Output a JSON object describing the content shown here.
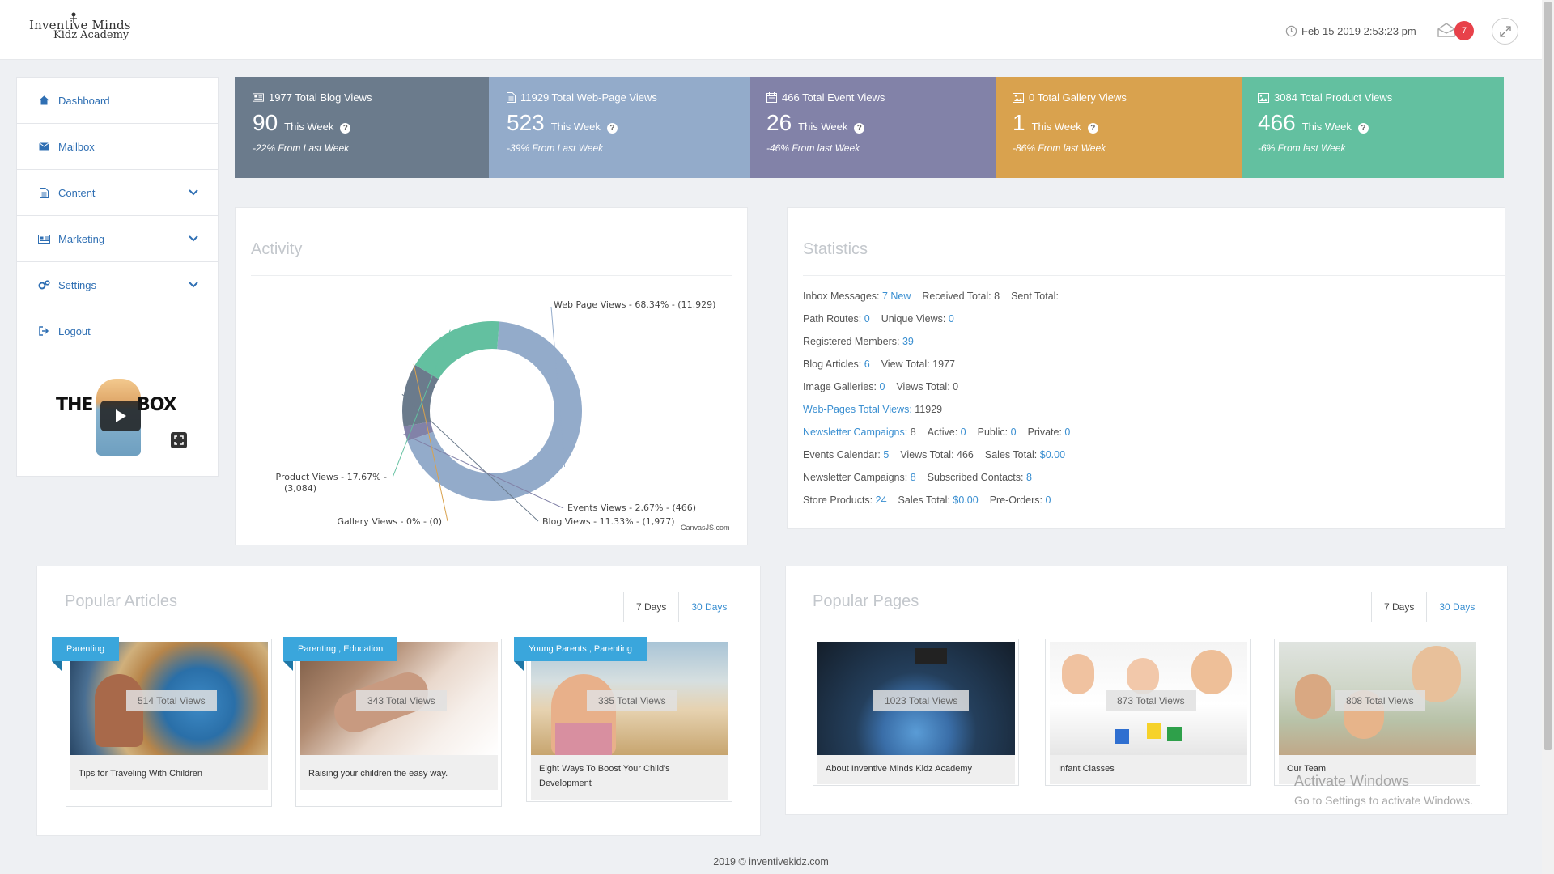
{
  "header": {
    "logo_line1": "Inventive Minds",
    "logo_line2": "Kidz Academy",
    "datetime": "Feb 15 2019 2:53:23 pm",
    "notification_count": "7"
  },
  "sidebar": {
    "items": [
      {
        "label": "Dashboard",
        "icon": "home-icon"
      },
      {
        "label": "Mailbox",
        "icon": "envelope-icon"
      },
      {
        "label": "Content",
        "icon": "document-icon",
        "expandable": true
      },
      {
        "label": "Marketing",
        "icon": "newspaper-icon",
        "expandable": true
      },
      {
        "label": "Settings",
        "icon": "gears-icon",
        "expandable": true
      },
      {
        "label": "Logout",
        "icon": "sign-out-icon"
      }
    ],
    "promo_left": "THE",
    "promo_right": "BOX"
  },
  "tiles": [
    {
      "heading": "1977 Total Blog Views",
      "number": "90",
      "period": "This Week",
      "change": "-22% From Last Week",
      "color": "#6b7b8c",
      "icon": "newspaper-icon"
    },
    {
      "heading": "11929 Total Web-Page Views",
      "number": "523",
      "period": "This Week",
      "change": "-39% From Last Week",
      "color": "#93abca",
      "icon": "file-icon"
    },
    {
      "heading": "466 Total Event Views",
      "number": "26",
      "period": "This Week",
      "change": "-46% From last Week",
      "color": "#8282a8",
      "icon": "calendar-icon"
    },
    {
      "heading": "0 Total Gallery Views",
      "number": "1",
      "period": "This Week",
      "change": "-86% From last Week",
      "color": "#d9a24e",
      "icon": "picture-icon"
    },
    {
      "heading": "3084 Total Product Views",
      "number": "466",
      "period": "This Week",
      "change": "-6% From last Week",
      "color": "#63c0a0",
      "icon": "picture-icon"
    }
  ],
  "activity": {
    "title": "Activity",
    "credit": "CanvasJS.com"
  },
  "chart_data": {
    "type": "pie",
    "donut": true,
    "categories": [
      "Web Page Views",
      "Events Views",
      "Blog Views",
      "Gallery Views",
      "Product Views"
    ],
    "values": [
      11929,
      466,
      1977,
      0,
      3084
    ],
    "labels": [
      "Web Page Views - 68.34% - (11,929)",
      "Events Views - 2.67% - (466)",
      "Blog Views - 11.33% - (1,977)",
      "Gallery Views - 0% - (0)",
      "Product Views - 17.67% -"
    ],
    "label_extra": "(3,084)",
    "colors": [
      "#93abca",
      "#8282a8",
      "#6b7b8c",
      "#d9a24e",
      "#63c0a0"
    ]
  },
  "statistics": {
    "title": "Statistics",
    "rows": [
      [
        {
          "t": "Inbox Messages: "
        },
        {
          "t": "7 New",
          "link": true
        },
        {
          "t": "Received Total: 8"
        },
        {
          "t": "Sent Total:"
        }
      ],
      [
        {
          "t": "Path Routes: "
        },
        {
          "t": "0",
          "link": true
        },
        {
          "t": "Unique Views: "
        },
        {
          "t": "0",
          "link": true
        }
      ],
      [
        {
          "t": "Registered Members: "
        },
        {
          "t": "39",
          "link": true
        }
      ],
      [
        {
          "t": "Blog Articles: "
        },
        {
          "t": "6",
          "link": true
        },
        {
          "t": "View Total: 1977"
        }
      ],
      [
        {
          "t": "Image Galleries: "
        },
        {
          "t": "0",
          "link": true
        },
        {
          "t": "Views Total: 0"
        }
      ],
      [
        {
          "t": "Web-Pages Total Views:",
          "link": true
        },
        {
          "t": " 11929"
        }
      ],
      [
        {
          "t": "Newsletter Campaigns:",
          "link": true
        },
        {
          "t": " 8"
        },
        {
          "t": "Active: "
        },
        {
          "t": "0",
          "link": true
        },
        {
          "t": "Public: "
        },
        {
          "t": "0",
          "link": true
        },
        {
          "t": "Private: "
        },
        {
          "t": "0",
          "link": true
        }
      ],
      [
        {
          "t": "Events Calendar: "
        },
        {
          "t": "5",
          "link": true
        },
        {
          "t": "Views Total: 466"
        },
        {
          "t": "Sales Total: "
        },
        {
          "t": "$0.00",
          "link": true
        }
      ],
      [
        {
          "t": "Newsletter Campaigns: "
        },
        {
          "t": "8",
          "link": true
        },
        {
          "t": "Subscribed Contacts: "
        },
        {
          "t": "8",
          "link": true
        }
      ],
      [
        {
          "t": "Store Products: "
        },
        {
          "t": "24",
          "link": true
        },
        {
          "t": "Sales Total: "
        },
        {
          "t": "$0.00",
          "link": true
        },
        {
          "t": "Pre-Orders: "
        },
        {
          "t": "0",
          "link": true
        }
      ]
    ]
  },
  "popular_articles": {
    "title": "Popular Articles",
    "tabs": [
      "7 Days",
      "30 Days"
    ],
    "cards": [
      {
        "ribbon": "Parenting",
        "views": "514 Total Views",
        "caption": "Tips for Traveling With Children"
      },
      {
        "ribbon": "Parenting , Education",
        "views": "343 Total Views",
        "caption": "Raising your children the easy way."
      },
      {
        "ribbon": "Young Parents , Parenting",
        "views": "335 Total Views",
        "caption": "Eight Ways To Boost Your Child's Development"
      }
    ]
  },
  "popular_pages": {
    "title": "Popular Pages",
    "tabs": [
      "7 Days",
      "30 Days"
    ],
    "cards": [
      {
        "views": "1023 Total Views",
        "caption": "About Inventive Minds Kidz Academy"
      },
      {
        "views": "873 Total Views",
        "caption": "Infant Classes"
      },
      {
        "views": "808 Total Views",
        "caption": "Our Team"
      }
    ]
  },
  "watermark": {
    "line1": "Activate Windows",
    "line2": "Go to Settings to activate Windows."
  },
  "footer": "2019 © inventivekidz.com"
}
